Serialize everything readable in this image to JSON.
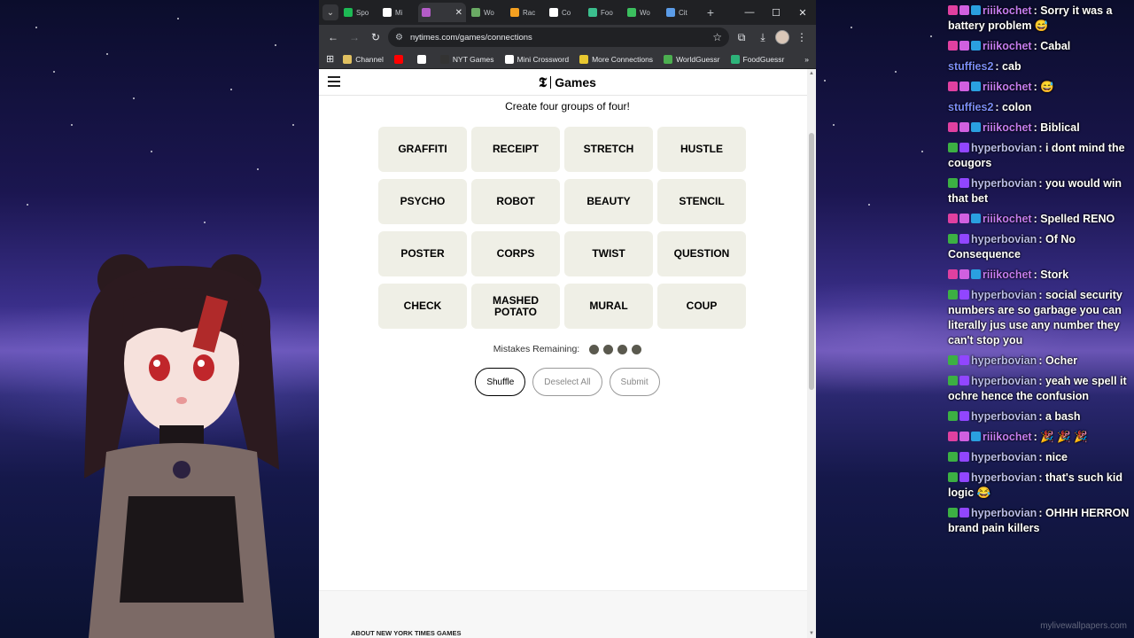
{
  "browser": {
    "tabs": [
      {
        "label": "Spo",
        "color": "#1db954"
      },
      {
        "label": "Mi",
        "color": "#ffffff"
      },
      {
        "label": "",
        "color": "#b45cc8",
        "active": true
      },
      {
        "label": "Wo",
        "color": "#6aaa64"
      },
      {
        "label": "Rac",
        "color": "#f4a020"
      },
      {
        "label": "Co",
        "color": "#ffffff"
      },
      {
        "label": "Foo",
        "color": "#3bbf8e"
      },
      {
        "label": "Wo",
        "color": "#3bbf5e"
      },
      {
        "label": "Cit",
        "color": "#5b9ce8"
      }
    ],
    "url": "nytimes.com/games/connections",
    "bookmarks": [
      {
        "label": "Channel",
        "color": "#e0c060"
      },
      {
        "label": "",
        "color": "#ff0000"
      },
      {
        "label": "",
        "color": "#ffffff"
      },
      {
        "label": "NYT Games",
        "color": "#333333"
      },
      {
        "label": "Mini Crossword",
        "color": "#ffffff"
      },
      {
        "label": "More Connections",
        "color": "#e8c830"
      },
      {
        "label": "WorldGuessr",
        "color": "#4caf50"
      },
      {
        "label": "FoodGuessr",
        "color": "#2db37a"
      }
    ]
  },
  "game": {
    "logo_text": "Games",
    "instructions": "Create four groups of four!",
    "tiles": [
      "GRAFFITI",
      "RECEIPT",
      "STRETCH",
      "HUSTLE",
      "PSYCHO",
      "ROBOT",
      "BEAUTY",
      "STENCIL",
      "POSTER",
      "CORPS",
      "TWIST",
      "QUESTION",
      "CHECK",
      "MASHED POTATO",
      "MURAL",
      "COUP"
    ],
    "mistakes_label": "Mistakes Remaining:",
    "mistakes_remaining": 4,
    "shuffle_label": "Shuffle",
    "deselect_label": "Deselect All",
    "submit_label": "Submit",
    "footer_label": "ABOUT NEW YORK TIMES GAMES"
  },
  "chat": [
    {
      "user": "riiikochet",
      "text": "Sorry it was a battery problem 😅",
      "cls": "riii"
    },
    {
      "user": "riiikochet",
      "text": "Cabal",
      "cls": "riii"
    },
    {
      "user": "stuffies2",
      "text": "cab",
      "cls": "stuff"
    },
    {
      "user": "riiikochet",
      "text": "😅",
      "cls": "riii"
    },
    {
      "user": "stuffies2",
      "text": "colon",
      "cls": "stuff"
    },
    {
      "user": "riiikochet",
      "text": "Biblical",
      "cls": "riii"
    },
    {
      "user": "hyperbovian",
      "text": "i dont mind the cougors",
      "cls": "hyper"
    },
    {
      "user": "hyperbovian",
      "text": "you would win that bet",
      "cls": "hyper"
    },
    {
      "user": "riiikochet",
      "text": "Spelled RENO",
      "cls": "riii"
    },
    {
      "user": "hyperbovian",
      "text": "Of No Consequence",
      "cls": "hyper"
    },
    {
      "user": "riiikochet",
      "text": "Stork",
      "cls": "riii"
    },
    {
      "user": "hyperbovian",
      "text": "social security numbers are so garbage you can literally jus use any number they can't stop you",
      "cls": "hyper"
    },
    {
      "user": "hyperbovian",
      "text": "Ocher",
      "cls": "hyper"
    },
    {
      "user": "hyperbovian",
      "text": "yeah we spell it ochre hence the confusion",
      "cls": "hyper"
    },
    {
      "user": "hyperbovian",
      "text": "a bash",
      "cls": "hyper"
    },
    {
      "user": "riiikochet",
      "text": "🎉 🎉 🎉",
      "cls": "riii"
    },
    {
      "user": "hyperbovian",
      "text": "nice",
      "cls": "hyper"
    },
    {
      "user": "hyperbovian",
      "text": "that's such kid logic 😂",
      "cls": "hyper"
    },
    {
      "user": "hyperbovian",
      "text": "OHHH HERRON brand pain killers",
      "cls": "hyper"
    }
  ],
  "watermark": "mylivewallpapers.com"
}
